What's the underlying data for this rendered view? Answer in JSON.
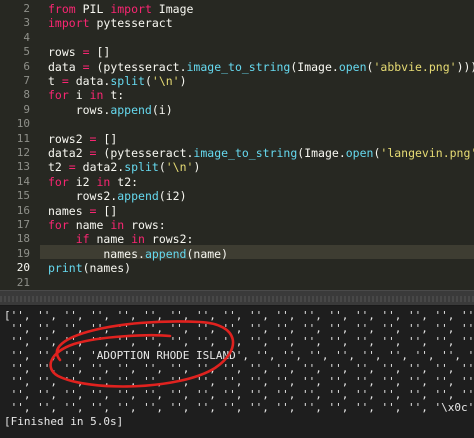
{
  "editor": {
    "current_line": "20",
    "line_numbers": [
      "2",
      "3",
      "4",
      "5",
      "6",
      "7",
      "8",
      "9",
      "10",
      "11",
      "12",
      "13",
      "14",
      "15",
      "16",
      "17",
      "18",
      "19",
      "20",
      "21"
    ],
    "lines": [
      [
        [
          "kw",
          "from"
        ],
        [
          "pl",
          " PIL "
        ],
        [
          "kw",
          "import"
        ],
        [
          "pl",
          " Image"
        ]
      ],
      [
        [
          "kw",
          "import"
        ],
        [
          "pl",
          " pytesseract"
        ]
      ],
      [],
      [
        [
          "pl",
          "rows "
        ],
        [
          "kw",
          "="
        ],
        [
          "pl",
          " []"
        ]
      ],
      [
        [
          "pl",
          "data "
        ],
        [
          "kw",
          "="
        ],
        [
          "pl",
          " (pytesseract."
        ],
        [
          "fn",
          "image_to_string"
        ],
        [
          "pl",
          "(Image."
        ],
        [
          "fn",
          "open"
        ],
        [
          "pl",
          "("
        ],
        [
          "st",
          "'abbvie.png'"
        ],
        [
          "pl",
          ")))"
        ]
      ],
      [
        [
          "pl",
          "t "
        ],
        [
          "kw",
          "="
        ],
        [
          "pl",
          " data."
        ],
        [
          "fn",
          "split"
        ],
        [
          "pl",
          "("
        ],
        [
          "st",
          "'\\n'"
        ],
        [
          "pl",
          ")"
        ]
      ],
      [
        [
          "kw",
          "for"
        ],
        [
          "pl",
          " i "
        ],
        [
          "kw",
          "in"
        ],
        [
          "pl",
          " t:"
        ]
      ],
      [
        [
          "pl",
          "    rows."
        ],
        [
          "fn",
          "append"
        ],
        [
          "pl",
          "(i)"
        ]
      ],
      [],
      [
        [
          "pl",
          "rows2 "
        ],
        [
          "kw",
          "="
        ],
        [
          "pl",
          " []"
        ]
      ],
      [
        [
          "pl",
          "data2 "
        ],
        [
          "kw",
          "="
        ],
        [
          "pl",
          " (pytesseract."
        ],
        [
          "fn",
          "image_to_string"
        ],
        [
          "pl",
          "(Image."
        ],
        [
          "fn",
          "open"
        ],
        [
          "pl",
          "("
        ],
        [
          "st",
          "'langevin.png'"
        ],
        [
          "pl",
          ")))"
        ]
      ],
      [
        [
          "pl",
          "t2 "
        ],
        [
          "kw",
          "="
        ],
        [
          "pl",
          " data2."
        ],
        [
          "fn",
          "split"
        ],
        [
          "pl",
          "("
        ],
        [
          "st",
          "'\\n'"
        ],
        [
          "pl",
          ")"
        ]
      ],
      [
        [
          "kw",
          "for"
        ],
        [
          "pl",
          " i2 "
        ],
        [
          "kw",
          "in"
        ],
        [
          "pl",
          " t2:"
        ]
      ],
      [
        [
          "pl",
          "    rows2."
        ],
        [
          "fn",
          "append"
        ],
        [
          "pl",
          "(i2)"
        ]
      ],
      [
        [
          "pl",
          "names "
        ],
        [
          "kw",
          "="
        ],
        [
          "pl",
          " []"
        ]
      ],
      [
        [
          "kw",
          "for"
        ],
        [
          "pl",
          " name "
        ],
        [
          "kw",
          "in"
        ],
        [
          "pl",
          " rows:"
        ]
      ],
      [
        [
          "pl",
          "    "
        ],
        [
          "kw",
          "if"
        ],
        [
          "pl",
          " name "
        ],
        [
          "kw",
          "in"
        ],
        [
          "pl",
          " rows2:"
        ]
      ],
      [
        [
          "pl",
          "        names."
        ],
        [
          "fn",
          "append"
        ],
        [
          "pl",
          "(name)"
        ]
      ],
      [
        [
          "fn",
          "print"
        ],
        [
          "pl",
          "(names)"
        ]
      ],
      []
    ]
  },
  "console": {
    "lines": [
      "['', '', '', '', '', '', '', '', '', '', '', '', '', '', '', '', '', '', '', '', '',",
      " '', '', '', '', '', '', '', '', '', '', '', '', '', '', '', '', '', '', '', '', '',",
      " '', '', '', '', '', '', '', '', '', '', '', '', '', '', '', '', '', '', '', '', '',",
      " '', '', '', 'ADOPTION RHODE ISLAND', '', '', '', '', '', '', '', '', '', '', '',",
      " '', '', '', '', '', '', '', '', '', '', '', '', '', '', '', '', '', '', '', '', '',",
      " '', '', '', '', '', '', '', '', '', '', '', '', '', '', '', '', '', '', '', '', '',",
      " '', '', '', '', '', '', '', '', '', '', '', '', '', '', '', '', '', '', '', '', '',",
      " '', '', '', '', '', '', '', '', '', '', '', '', '', '', '', '', '\\x0c']",
      "[Finished in 5.0s]"
    ],
    "annotation_color": "#e0221f"
  }
}
